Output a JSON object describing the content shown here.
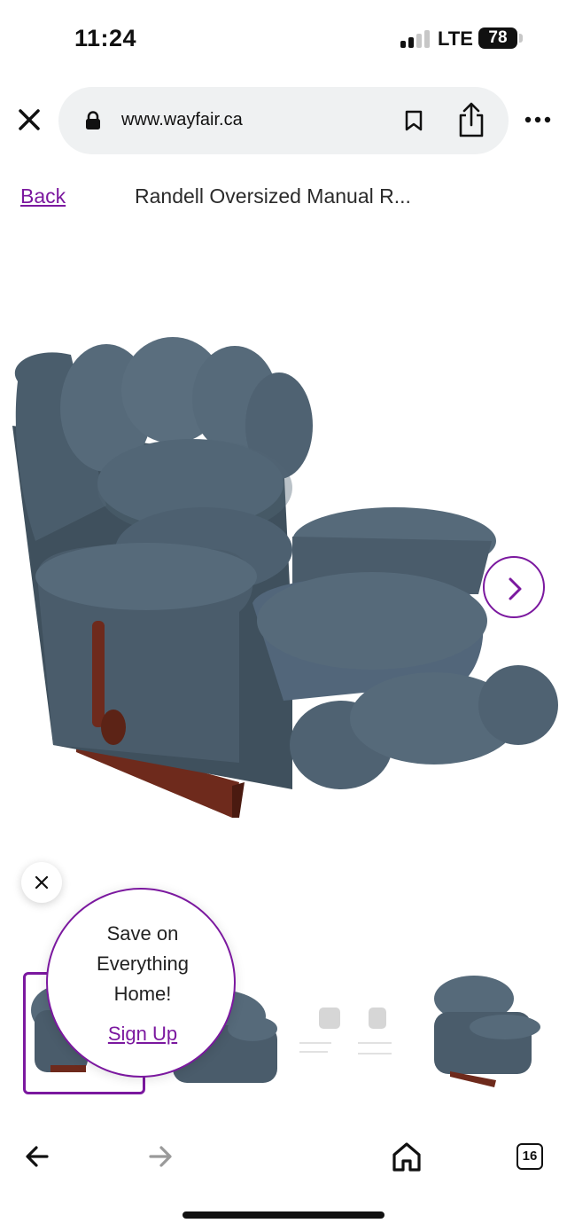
{
  "status_bar": {
    "time": "11:24",
    "network": "LTE",
    "battery": "78",
    "signal_bars": 2,
    "signal_bars_total": 4
  },
  "browser": {
    "url": "www.wayfair.ca",
    "icons": [
      "close-icon",
      "lock-icon",
      "bookmark-icon",
      "share-icon",
      "more-icon"
    ]
  },
  "page": {
    "back_label": "Back",
    "product_title": "Randell Oversized Manual R..."
  },
  "gallery": {
    "next_icon": "chevron-right-icon",
    "thumbnail_count": 4,
    "selected_thumbnail": 1
  },
  "promo": {
    "line1": "Save on",
    "line2": "Everything",
    "line3": "Home!",
    "signup": "Sign Up"
  },
  "bottom_bar": {
    "tab_count": "16",
    "icons": [
      "back-arrow-icon",
      "forward-arrow-icon",
      "home-icon",
      "tabs-icon"
    ]
  },
  "colors": {
    "accent": "#7b189f",
    "url_bar_bg": "#eff1f2",
    "upholstery": "#4f6272",
    "wood": "#6e2a1c"
  }
}
